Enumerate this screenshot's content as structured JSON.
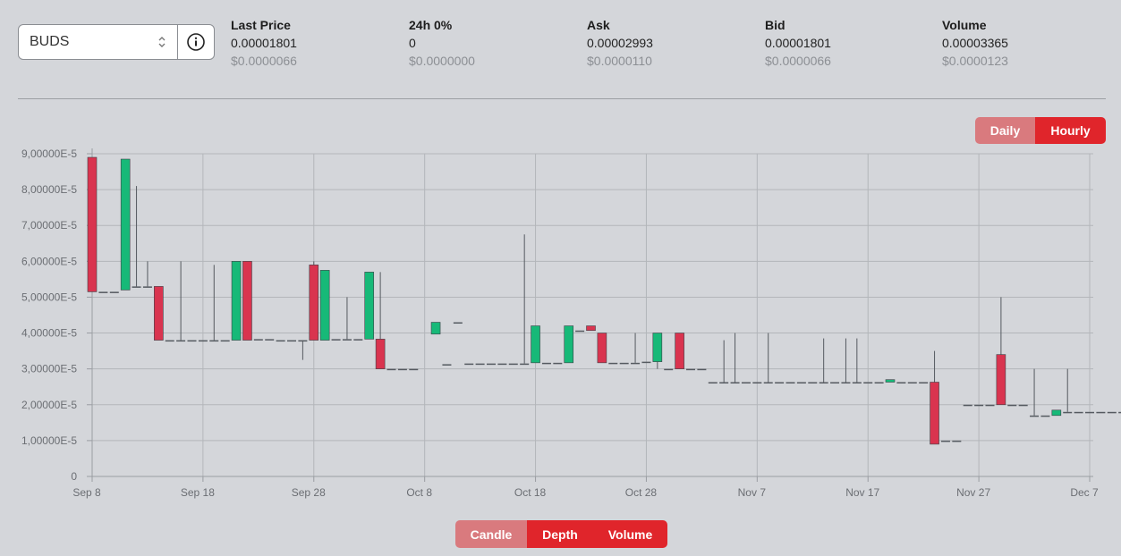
{
  "selector": {
    "value": "BUDS"
  },
  "stats": [
    {
      "label": "Last Price",
      "value": "0.00001801",
      "usd": "$0.0000066"
    },
    {
      "label": "24h 0%",
      "value": "0",
      "usd": "$0.0000000"
    },
    {
      "label": "Ask",
      "value": "0.00002993",
      "usd": "$0.0000110"
    },
    {
      "label": "Bid",
      "value": "0.00001801",
      "usd": "$0.0000066"
    },
    {
      "label": "Volume",
      "value": "0.00003365",
      "usd": "$0.0000123"
    }
  ],
  "interval_toggle": {
    "daily": "Daily",
    "hourly": "Hourly",
    "active": "hourly"
  },
  "view_toggle": {
    "candle": "Candle",
    "depth": "Depth",
    "volume": "Volume",
    "active": [
      "depth",
      "volume"
    ]
  },
  "colors": {
    "up": "#17b978",
    "down": "#d9344f",
    "wick": "#555a60",
    "accent": "#e0252b"
  },
  "chart_data": {
    "type": "candlestick",
    "y_ticks": [
      "0",
      "1,00000E-5",
      "2,00000E-5",
      "3,00000E-5",
      "4,00000E-5",
      "5,00000E-5",
      "6,00000E-5",
      "7,00000E-5",
      "8,00000E-5",
      "9,00000E-5"
    ],
    "ylim": [
      0,
      9.0
    ],
    "y_unit": "E-5",
    "x_ticks": [
      "Sep 8",
      "Sep 18",
      "Sep 28",
      "Oct 8",
      "Oct 18",
      "Oct 28",
      "Nov 7",
      "Nov 17",
      "Nov 27",
      "Dec 7"
    ],
    "x_tick_days": [
      0,
      10,
      20,
      30,
      40,
      50,
      60,
      70,
      80,
      90
    ],
    "grid": true,
    "candles": [
      {
        "d": 0,
        "o": 8.9,
        "h": 8.9,
        "l": 5.15,
        "c": 5.15
      },
      {
        "d": 1,
        "o": 5.15,
        "h": 5.15,
        "l": 5.15,
        "c": 5.15
      },
      {
        "d": 2,
        "o": 5.15,
        "h": 5.15,
        "l": 5.15,
        "c": 5.15
      },
      {
        "d": 3,
        "o": 5.2,
        "h": 8.85,
        "l": 5.2,
        "c": 8.85
      },
      {
        "d": 4,
        "o": 5.3,
        "h": 8.1,
        "l": 5.3,
        "c": 5.3
      },
      {
        "d": 5,
        "o": 5.3,
        "h": 6.0,
        "l": 5.3,
        "c": 5.3
      },
      {
        "d": 6,
        "o": 5.3,
        "h": 5.3,
        "l": 3.8,
        "c": 3.8
      },
      {
        "d": 7,
        "o": 3.8,
        "h": 3.8,
        "l": 3.8,
        "c": 3.8
      },
      {
        "d": 8,
        "o": 3.8,
        "h": 6.0,
        "l": 3.8,
        "c": 3.8
      },
      {
        "d": 9,
        "o": 3.8,
        "h": 3.8,
        "l": 3.8,
        "c": 3.8
      },
      {
        "d": 10,
        "o": 3.8,
        "h": 3.8,
        "l": 3.8,
        "c": 3.8
      },
      {
        "d": 11,
        "o": 3.8,
        "h": 5.9,
        "l": 3.8,
        "c": 3.8
      },
      {
        "d": 12,
        "o": 3.8,
        "h": 3.8,
        "l": 3.8,
        "c": 3.8
      },
      {
        "d": 13,
        "o": 3.8,
        "h": 6.0,
        "l": 3.8,
        "c": 6.0
      },
      {
        "d": 14,
        "o": 6.0,
        "h": 6.0,
        "l": 3.8,
        "c": 3.8
      },
      {
        "d": 15,
        "o": 3.83,
        "h": 3.83,
        "l": 3.83,
        "c": 3.83
      },
      {
        "d": 16,
        "o": 3.83,
        "h": 3.83,
        "l": 3.83,
        "c": 3.83
      },
      {
        "d": 17,
        "o": 3.8,
        "h": 3.8,
        "l": 3.8,
        "c": 3.8
      },
      {
        "d": 18,
        "o": 3.8,
        "h": 3.8,
        "l": 3.8,
        "c": 3.8
      },
      {
        "d": 19,
        "o": 3.8,
        "h": 3.8,
        "l": 3.25,
        "c": 3.8
      },
      {
        "d": 20,
        "o": 5.9,
        "h": 6.0,
        "l": 3.8,
        "c": 3.8
      },
      {
        "d": 21,
        "o": 3.8,
        "h": 5.75,
        "l": 3.8,
        "c": 5.75
      },
      {
        "d": 22,
        "o": 3.83,
        "h": 3.83,
        "l": 3.83,
        "c": 3.83
      },
      {
        "d": 23,
        "o": 3.83,
        "h": 5.0,
        "l": 3.83,
        "c": 3.83
      },
      {
        "d": 24,
        "o": 3.83,
        "h": 3.83,
        "l": 3.83,
        "c": 3.83
      },
      {
        "d": 25,
        "o": 3.83,
        "h": 5.7,
        "l": 3.83,
        "c": 5.7
      },
      {
        "d": 26,
        "o": 3.83,
        "h": 5.7,
        "l": 3.83,
        "c": 3.83
      },
      {
        "d": 26,
        "o": 3.83,
        "h": 3.83,
        "l": 3.0,
        "c": 3.0
      },
      {
        "d": 27,
        "o": 3.0,
        "h": 3.0,
        "l": 3.0,
        "c": 3.0
      },
      {
        "d": 28,
        "o": 3.0,
        "h": 3.0,
        "l": 3.0,
        "c": 3.0
      },
      {
        "d": 29,
        "o": 3.0,
        "h": 3.0,
        "l": 3.0,
        "c": 3.0
      },
      {
        "d": 31,
        "o": 3.97,
        "h": 4.3,
        "l": 3.97,
        "c": 4.3
      },
      {
        "d": 32,
        "o": 3.13,
        "h": 3.13,
        "l": 3.13,
        "c": 3.13
      },
      {
        "d": 33,
        "o": 4.3,
        "h": 4.3,
        "l": 4.3,
        "c": 4.3
      },
      {
        "d": 34,
        "o": 3.15,
        "h": 3.15,
        "l": 3.15,
        "c": 3.15
      },
      {
        "d": 35,
        "o": 3.15,
        "h": 3.15,
        "l": 3.15,
        "c": 3.15
      },
      {
        "d": 36,
        "o": 3.15,
        "h": 3.15,
        "l": 3.15,
        "c": 3.15
      },
      {
        "d": 37,
        "o": 3.15,
        "h": 3.15,
        "l": 3.15,
        "c": 3.15
      },
      {
        "d": 38,
        "o": 3.15,
        "h": 3.15,
        "l": 3.15,
        "c": 3.15
      },
      {
        "d": 39,
        "o": 3.15,
        "h": 6.75,
        "l": 3.15,
        "c": 3.15
      },
      {
        "d": 40,
        "o": 3.17,
        "h": 4.2,
        "l": 3.17,
        "c": 4.2
      },
      {
        "d": 41,
        "o": 3.17,
        "h": 3.17,
        "l": 3.17,
        "c": 3.17
      },
      {
        "d": 42,
        "o": 3.17,
        "h": 3.17,
        "l": 3.17,
        "c": 3.17
      },
      {
        "d": 43,
        "o": 3.17,
        "h": 4.2,
        "l": 3.17,
        "c": 4.2
      },
      {
        "d": 44,
        "o": 4.07,
        "h": 4.07,
        "l": 4.07,
        "c": 4.07
      },
      {
        "d": 45,
        "o": 4.2,
        "h": 4.2,
        "l": 4.07,
        "c": 4.07
      },
      {
        "d": 46,
        "o": 4.0,
        "h": 4.0,
        "l": 3.17,
        "c": 3.17
      },
      {
        "d": 47,
        "o": 3.17,
        "h": 3.17,
        "l": 3.17,
        "c": 3.17
      },
      {
        "d": 48,
        "o": 3.17,
        "h": 3.17,
        "l": 3.17,
        "c": 3.17
      },
      {
        "d": 49,
        "o": 3.17,
        "h": 4.0,
        "l": 3.17,
        "c": 3.17
      },
      {
        "d": 50,
        "o": 3.2,
        "h": 3.2,
        "l": 3.2,
        "c": 3.2
      },
      {
        "d": 51,
        "o": 3.2,
        "h": 4.0,
        "l": 3.0,
        "c": 4.0
      },
      {
        "d": 52,
        "o": 3.0,
        "h": 3.0,
        "l": 3.0,
        "c": 3.0
      },
      {
        "d": 53,
        "o": 4.0,
        "h": 4.0,
        "l": 3.0,
        "c": 3.0
      },
      {
        "d": 54,
        "o": 3.0,
        "h": 3.0,
        "l": 3.0,
        "c": 3.0
      },
      {
        "d": 55,
        "o": 3.0,
        "h": 3.0,
        "l": 3.0,
        "c": 3.0
      },
      {
        "d": 56,
        "o": 2.63,
        "h": 2.63,
        "l": 2.63,
        "c": 2.63
      },
      {
        "d": 57,
        "o": 2.63,
        "h": 3.8,
        "l": 2.63,
        "c": 2.63
      },
      {
        "d": 58,
        "o": 2.63,
        "h": 4.0,
        "l": 2.63,
        "c": 2.63
      },
      {
        "d": 59,
        "o": 2.63,
        "h": 2.63,
        "l": 2.63,
        "c": 2.63
      },
      {
        "d": 60,
        "o": 2.63,
        "h": 2.63,
        "l": 2.63,
        "c": 2.63
      },
      {
        "d": 61,
        "o": 2.63,
        "h": 4.0,
        "l": 2.63,
        "c": 2.63
      },
      {
        "d": 62,
        "o": 2.63,
        "h": 2.63,
        "l": 2.63,
        "c": 2.63
      },
      {
        "d": 63,
        "o": 2.63,
        "h": 2.63,
        "l": 2.63,
        "c": 2.63
      },
      {
        "d": 64,
        "o": 2.63,
        "h": 2.63,
        "l": 2.63,
        "c": 2.63
      },
      {
        "d": 65,
        "o": 2.63,
        "h": 2.63,
        "l": 2.63,
        "c": 2.63
      },
      {
        "d": 66,
        "o": 2.63,
        "h": 3.85,
        "l": 2.63,
        "c": 2.63
      },
      {
        "d": 67,
        "o": 2.63,
        "h": 2.63,
        "l": 2.63,
        "c": 2.63
      },
      {
        "d": 68,
        "o": 2.63,
        "h": 3.85,
        "l": 2.63,
        "c": 2.63
      },
      {
        "d": 69,
        "o": 2.63,
        "h": 3.85,
        "l": 2.63,
        "c": 2.63
      },
      {
        "d": 70,
        "o": 2.63,
        "h": 2.63,
        "l": 2.63,
        "c": 2.63
      },
      {
        "d": 71,
        "o": 2.63,
        "h": 2.63,
        "l": 2.63,
        "c": 2.63
      },
      {
        "d": 72,
        "o": 2.63,
        "h": 2.7,
        "l": 2.63,
        "c": 2.7
      },
      {
        "d": 73,
        "o": 2.63,
        "h": 2.63,
        "l": 2.63,
        "c": 2.63
      },
      {
        "d": 74,
        "o": 2.63,
        "h": 2.63,
        "l": 2.63,
        "c": 2.63
      },
      {
        "d": 75,
        "o": 2.63,
        "h": 2.63,
        "l": 2.63,
        "c": 2.63
      },
      {
        "d": 76,
        "o": 2.63,
        "h": 3.5,
        "l": 0.9,
        "c": 0.9
      },
      {
        "d": 77,
        "o": 1.0,
        "h": 1.0,
        "l": 1.0,
        "c": 1.0
      },
      {
        "d": 78,
        "o": 1.0,
        "h": 1.0,
        "l": 1.0,
        "c": 1.0
      },
      {
        "d": 79,
        "o": 2.0,
        "h": 2.0,
        "l": 2.0,
        "c": 2.0
      },
      {
        "d": 80,
        "o": 2.0,
        "h": 2.0,
        "l": 2.0,
        "c": 2.0
      },
      {
        "d": 81,
        "o": 2.0,
        "h": 2.0,
        "l": 2.0,
        "c": 2.0
      },
      {
        "d": 82,
        "o": 3.4,
        "h": 5.0,
        "l": 2.0,
        "c": 2.0
      },
      {
        "d": 83,
        "o": 2.0,
        "h": 2.0,
        "l": 2.0,
        "c": 2.0
      },
      {
        "d": 84,
        "o": 2.0,
        "h": 2.0,
        "l": 2.0,
        "c": 2.0
      },
      {
        "d": 85,
        "o": 1.7,
        "h": 3.0,
        "l": 1.7,
        "c": 1.7
      },
      {
        "d": 86,
        "o": 1.7,
        "h": 1.7,
        "l": 1.7,
        "c": 1.7
      },
      {
        "d": 87,
        "o": 1.7,
        "h": 1.85,
        "l": 1.7,
        "c": 1.85
      },
      {
        "d": 88,
        "o": 1.8,
        "h": 3.0,
        "l": 1.8,
        "c": 1.8
      },
      {
        "d": 89,
        "o": 1.8,
        "h": 1.8,
        "l": 1.8,
        "c": 1.8
      },
      {
        "d": 90,
        "o": 1.8,
        "h": 1.8,
        "l": 1.8,
        "c": 1.8
      },
      {
        "d": 91,
        "o": 1.8,
        "h": 1.8,
        "l": 1.8,
        "c": 1.8
      },
      {
        "d": 92,
        "o": 1.8,
        "h": 1.8,
        "l": 1.8,
        "c": 1.8
      },
      {
        "d": 93,
        "o": 1.8,
        "h": 1.8,
        "l": 1.8,
        "c": 1.8
      },
      {
        "d": 94,
        "o": 1.8,
        "h": 1.8,
        "l": 1.8,
        "c": 1.8
      },
      {
        "d": 95,
        "o": 1.8,
        "h": 1.8,
        "l": 1.8,
        "c": 1.8
      }
    ]
  }
}
